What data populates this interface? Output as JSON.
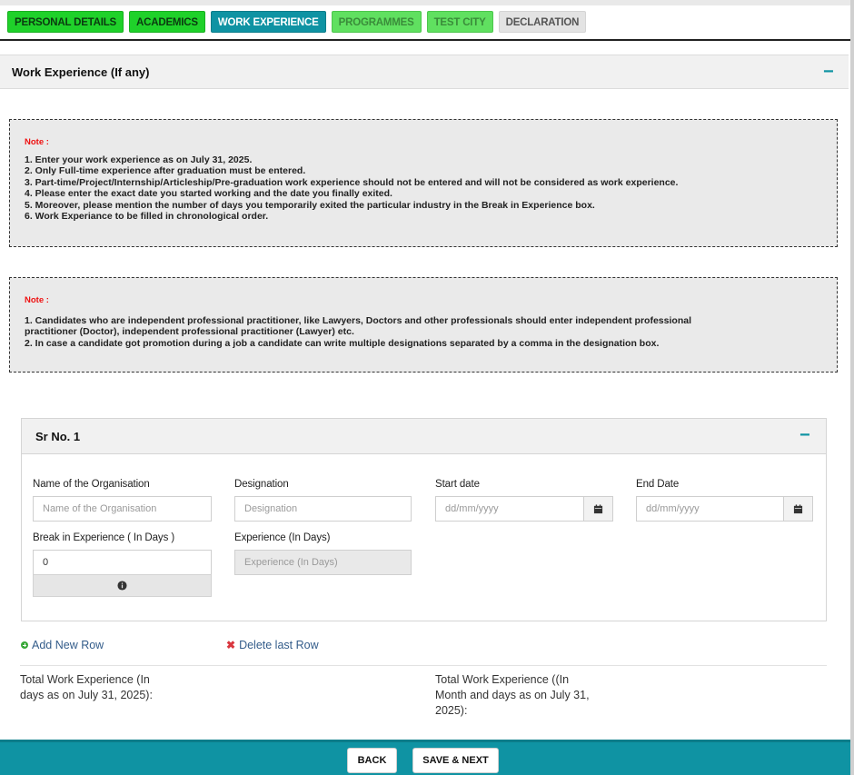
{
  "tabs": [
    {
      "label": "PERSONAL DETAILS",
      "state": "done"
    },
    {
      "label": "ACADEMICS",
      "state": "done"
    },
    {
      "label": "WORK EXPERIENCE",
      "state": "active"
    },
    {
      "label": "PROGRAMMES",
      "state": "pending"
    },
    {
      "label": "TEST CITY",
      "state": "pending"
    },
    {
      "label": "DECLARATION",
      "state": "disabled"
    }
  ],
  "section": {
    "title": "Work Experience (If any)",
    "collapse_symbol": "−"
  },
  "note1": {
    "label": "Note :",
    "lines": [
      "1. Enter your work experience as on July 31, 2025.",
      "2. Only Full-time experience after graduation must be entered.",
      "3. Part-time/Project/Internship/Articleship/Pre-graduation work experience should not be entered and will not be considered as work experience.",
      "4. Please enter the exact date you started working and the date you finally exited.",
      "5. Moreover, please mention the number of days you temporarily exited the particular industry in the Break in Experience box.",
      "6. Work Experiance to be filled in chronological order."
    ]
  },
  "note2": {
    "label": "Note :",
    "lines": [
      "1. Candidates who are independent professional practitioner, like Lawyers, Doctors and other professionals should enter independent professional",
      "practitioner (Doctor), independent professional practitioner (Lawyer) etc.",
      "2. In case a candidate got promotion during a job a candidate can write multiple designations separated by a comma in the designation box."
    ]
  },
  "row": {
    "title": "Sr No. 1",
    "collapse_symbol": "−",
    "organisation": {
      "label": "Name of the Organisation",
      "placeholder": "Name of the Organisation",
      "value": ""
    },
    "designation": {
      "label": "Designation",
      "placeholder": "Designation",
      "value": ""
    },
    "start_date": {
      "label": "Start date",
      "placeholder": "dd/mm/yyyy",
      "value": ""
    },
    "end_date": {
      "label": "End Date",
      "placeholder": "dd/mm/yyyy",
      "value": ""
    },
    "break": {
      "label": "Break in Experience ( In Days )",
      "value": "0"
    },
    "experience": {
      "label": "Experience (In Days)",
      "placeholder": "Experience (In Days)",
      "value": ""
    }
  },
  "actions": {
    "add_row": "Add New Row",
    "delete_row": "Delete last Row"
  },
  "totals": {
    "days_label_line1": "Total Work Experience (In",
    "days_label_line2": "days as on July 31, 2025):",
    "months_label_line1": "Total Work Experience ((In",
    "months_label_line2": "Month and days as on July 31,",
    "months_label_line3": "2025):"
  },
  "footer": {
    "back": "BACK",
    "save_next": "SAVE & NEXT"
  },
  "colors": {
    "accent": "#0f93a3",
    "done_tab": "#1fd12a",
    "note_label": "#ee1111"
  },
  "icons": {
    "calendar": "calendar-icon",
    "info": "info-icon",
    "add": "plus-circle-icon",
    "delete": "close-icon"
  }
}
